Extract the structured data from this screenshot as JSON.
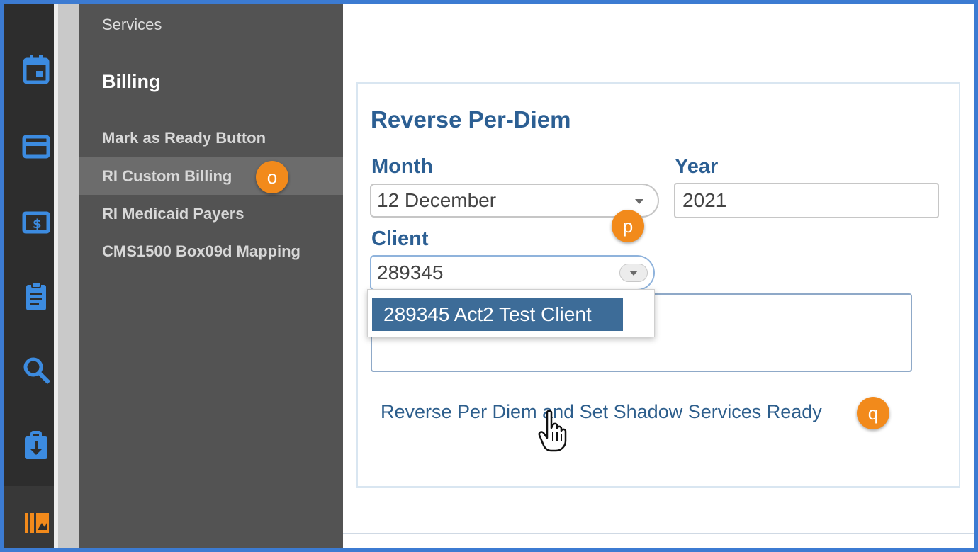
{
  "menu": {
    "services_label": "Services",
    "billing_heading": "Billing",
    "items": [
      {
        "label": "Mark as Ready Button"
      },
      {
        "label": "RI Custom Billing"
      },
      {
        "label": "RI Medicaid Payers"
      },
      {
        "label": "CMS1500 Box09d Mapping"
      }
    ]
  },
  "rail_icons": [
    "calendar-icon",
    "credit-card-icon",
    "dollar-bill-icon",
    "clipboard-icon",
    "search-icon",
    "briefcase-download-icon",
    "library-icon"
  ],
  "callouts": {
    "o": "o",
    "p": "p",
    "q": "q"
  },
  "form": {
    "title": "Reverse Per-Diem",
    "month_label": "Month",
    "month_value": "12 December",
    "year_label": "Year",
    "year_value": "2021",
    "client_label": "Client",
    "client_value": "289345",
    "client_options": [
      "289345 Act2 Test Client"
    ],
    "action_link": "Reverse Per Diem and Set Shadow Services Ready"
  },
  "colors": {
    "accent_blue": "#3c7bd2",
    "heading_blue": "#2c5f93",
    "callout_orange": "#f28a1b",
    "selected_option": "#3d6c98"
  }
}
